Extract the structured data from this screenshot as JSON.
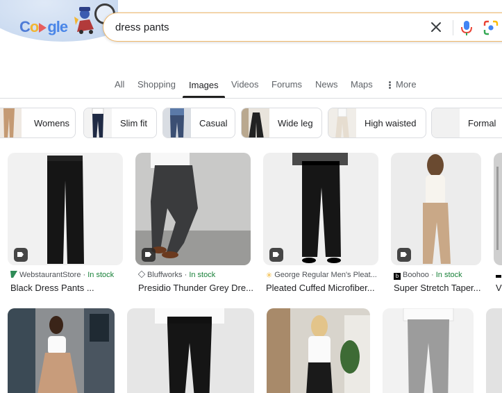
{
  "search": {
    "query": "dress pants"
  },
  "logo": {
    "letters": [
      "C",
      "gle"
    ]
  },
  "tabs": [
    {
      "label": "All"
    },
    {
      "label": "Shopping"
    },
    {
      "label": "Images"
    },
    {
      "label": "Videos"
    },
    {
      "label": "Forums"
    },
    {
      "label": "News"
    },
    {
      "label": "Maps"
    },
    {
      "label": "More"
    }
  ],
  "active_tab": "Images",
  "chips": [
    {
      "label": "Womens"
    },
    {
      "label": "Slim fit"
    },
    {
      "label": "Casual"
    },
    {
      "label": "Wide leg"
    },
    {
      "label": "High waisted"
    },
    {
      "label": "Formal"
    }
  ],
  "results": [
    {
      "source": "WebstaurantStore",
      "stock": "In stock",
      "title": "Black Dress Pants ..."
    },
    {
      "source": "Bluffworks",
      "stock": "In stock",
      "title": "Presidio Thunder Grey Dre..."
    },
    {
      "source": "George Regular Men's Pleat...",
      "stock": "",
      "title": "Pleated Cuffed Microfiber..."
    },
    {
      "source": "Boohoo",
      "stock": "In stock",
      "title": "Super Stretch Taper..."
    },
    {
      "source": "",
      "stock": "",
      "title": "V"
    }
  ],
  "colors": {
    "accent_tab": "#1f1f1f",
    "in_stock": "#188038",
    "search_border": "#f0b86a",
    "mic_blue": "#4285f4",
    "mic_red": "#ea4335"
  },
  "icons": [
    "clear-icon",
    "microphone-icon",
    "google-lens-icon",
    "more-vertical-icon",
    "shopping-tag-icon"
  ]
}
